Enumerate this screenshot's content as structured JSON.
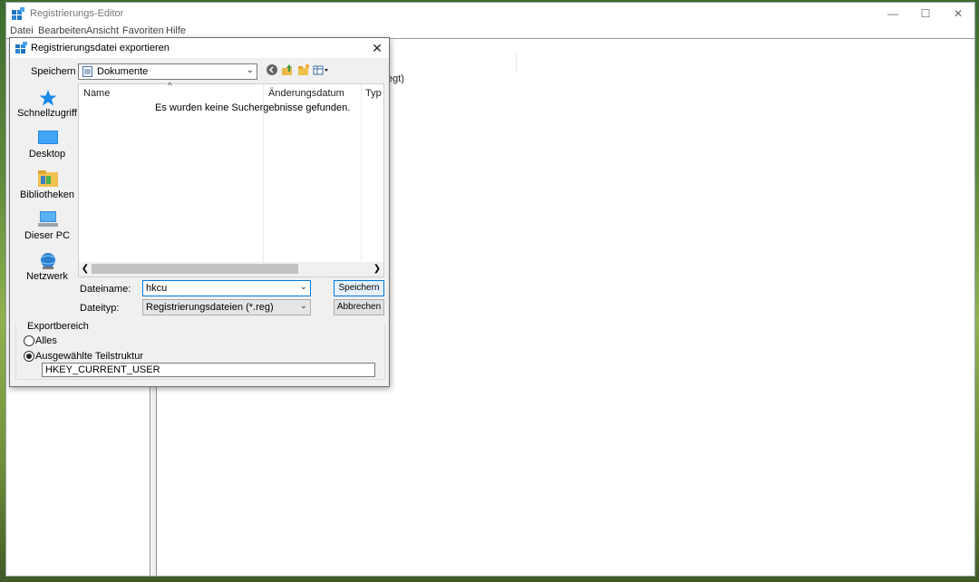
{
  "regedit": {
    "title": "Registrierungs-Editor",
    "menu": [
      "Datei",
      "Bearbeiten",
      "Ansicht",
      "Favoriten",
      "Hilfe"
    ],
    "values_partial_text": "egt)"
  },
  "dialog": {
    "title": "Registrierungsdatei exportieren",
    "save_in_label": "Speichern in:",
    "save_in_value": "Dokumente",
    "places": [
      "Schnellzugriff",
      "Desktop",
      "Bibliotheken",
      "Dieser PC",
      "Netzwerk"
    ],
    "columns": [
      "Name",
      "Änderungsdatum",
      "Typ"
    ],
    "empty_message": "Es wurden keine Suchergebnisse gefunden.",
    "filename_label": "Dateiname:",
    "filename_value": "hkcu",
    "filetype_label": "Dateityp:",
    "filetype_value": "Registrierungsdateien (*.reg)",
    "save_button": "Speichern",
    "cancel_button": "Abbrechen",
    "export_range_label": "Exportbereich",
    "option_all": "Alles",
    "option_branch": "Ausgewählte Teilstruktur",
    "branch_value": "HKEY_CURRENT_USER"
  },
  "colors": {
    "accent": "#0078d7",
    "window_bg": "#f0f0f0"
  }
}
